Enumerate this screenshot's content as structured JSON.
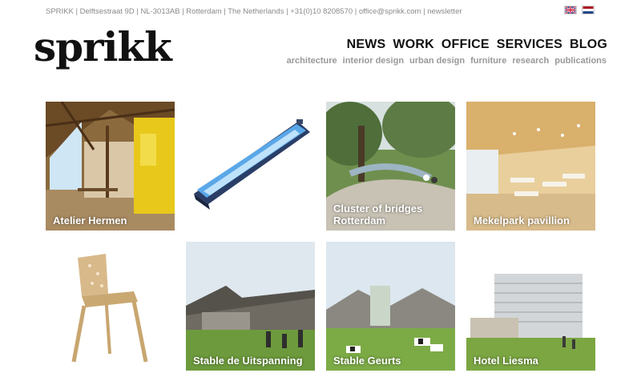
{
  "topbar": {
    "address": "SPRIKK | Delftsestraat 9D | NL-3013AB | Rotterdam | The Netherlands | +31(0)10 8208570 | ",
    "email": "office@sprikk.com",
    "separator": " | ",
    "newsletter": "newsletter"
  },
  "flags": [
    "uk-flag",
    "nl-flag"
  ],
  "logo": "sprikk",
  "main_nav": [
    "NEWS",
    "WORK",
    "OFFICE",
    "SERVICES",
    "BLOG"
  ],
  "sub_nav": [
    "architecture",
    "interior design",
    "urban design",
    "furniture",
    "research",
    "publications"
  ],
  "projects": [
    {
      "caption": "Atelier Hermen",
      "image": "barn-interior"
    },
    {
      "caption": "",
      "image": "boat-model"
    },
    {
      "caption": "Cluster of bridges Rotterdam",
      "image": "park-bridges"
    },
    {
      "caption": "Mekelpark pavillion",
      "image": "pavilion-interior"
    },
    {
      "caption": "",
      "image": "wooden-chair"
    },
    {
      "caption": "Stable de Uitspanning",
      "image": "stable-barn"
    },
    {
      "caption": "Stable Geurts",
      "image": "stable-cows"
    },
    {
      "caption": "Hotel Liesma",
      "image": "hotel-building"
    }
  ],
  "colors": {
    "nav": "#111111",
    "subnav": "#999999",
    "topbar": "#8a8a8a",
    "caption": "#ffffff"
  }
}
